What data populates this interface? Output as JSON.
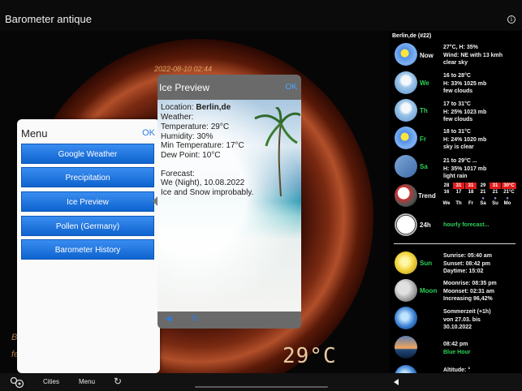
{
  "app": {
    "title": "Barometer antique"
  },
  "barometer": {
    "datetime": "2022-08-10 02:44",
    "temperature_display": "29°C",
    "side_text_1": "B",
    "side_text_2": "fe"
  },
  "menu": {
    "title": "Menu",
    "ok": "OK",
    "items": [
      {
        "label": "Google Weather"
      },
      {
        "label": "Precipitation"
      },
      {
        "label": "Ice Preview"
      },
      {
        "label": "Pollen (Germany)"
      },
      {
        "label": "Barometer History"
      }
    ]
  },
  "ice_preview": {
    "title": "Ice Preview",
    "ok": "OK",
    "location_label": "Location: ",
    "location_value": "Berlin,de",
    "weather_label": "Weather:",
    "temperature": "Temperature: 29°C",
    "humidity": "Humidity: 30%",
    "min_temperature": "Min Temperature: 17°C",
    "dew_point": "Dew Point: 10°C",
    "forecast_label": "Forecast:",
    "forecast_day": "We (Night), 10.08.2022",
    "forecast_text": "Ice and Snow improbably."
  },
  "forecast_panel": {
    "location": "Berlin,de (#22)",
    "rows": [
      {
        "label": "Now",
        "label_color": "white",
        "icon": "sun-icon",
        "lines": [
          "27°C, H: 35%",
          "Wind: NE with 13 kmh",
          "clear sky"
        ]
      },
      {
        "label": "We",
        "label_color": "green",
        "icon": "cloud-icon",
        "lines": [
          "16 to 28°C",
          "H: 33% 1025 mb",
          "few clouds"
        ]
      },
      {
        "label": "Th",
        "label_color": "green",
        "icon": "cloud-icon",
        "lines": [
          "17 to 31°C",
          "H: 25% 1023 mb",
          "few clouds"
        ]
      },
      {
        "label": "Fr",
        "label_color": "green",
        "icon": "sun-icon",
        "lines": [
          "18 to 31°C",
          "H: 24% 1020 mb",
          "sky is clear"
        ]
      },
      {
        "label": "Sa",
        "label_color": "green",
        "icon": "rain-icon",
        "lines": [
          "21 to 29°C ...",
          "H: 35% 1017 mb",
          "light rain"
        ]
      }
    ],
    "trend": {
      "label": "Trend",
      "max_row": [
        "28",
        "31",
        "31",
        "29",
        "31",
        "30°C"
      ],
      "min_row": [
        "16",
        "17",
        "18",
        "21",
        "21",
        "21°C"
      ],
      "days": [
        "We",
        "Th",
        "Fr",
        "Sa",
        "Su",
        "Mo"
      ]
    },
    "hourly": {
      "label": "24h",
      "text": "hourly forecast..."
    },
    "sun": {
      "label": "Sun",
      "lines": [
        "Sunrise: 05:40 am",
        "Sunset: 08:42 pm",
        "Daytime: 15:02"
      ]
    },
    "moon": {
      "label": "Moon",
      "lines": [
        "Moonrise: 08:35 pm",
        "Moonset: 02:31 am",
        "Increasing 96,42%"
      ]
    },
    "summertime": {
      "lines": [
        "Sommerzeit (+1h)",
        "von 27.03. bis",
        "30.10.2022"
      ]
    },
    "blue_hour": {
      "time": "08:42 pm",
      "label": "Blue Hour"
    },
    "altitude": {
      "text": "Altitude: °"
    }
  },
  "bottom_bar": {
    "cities": "Cities",
    "menu": "Menu"
  },
  "colors": {
    "accent_blue": "#2d7de0",
    "green": "#2bd15a",
    "trend_red": "#e21a1a"
  }
}
